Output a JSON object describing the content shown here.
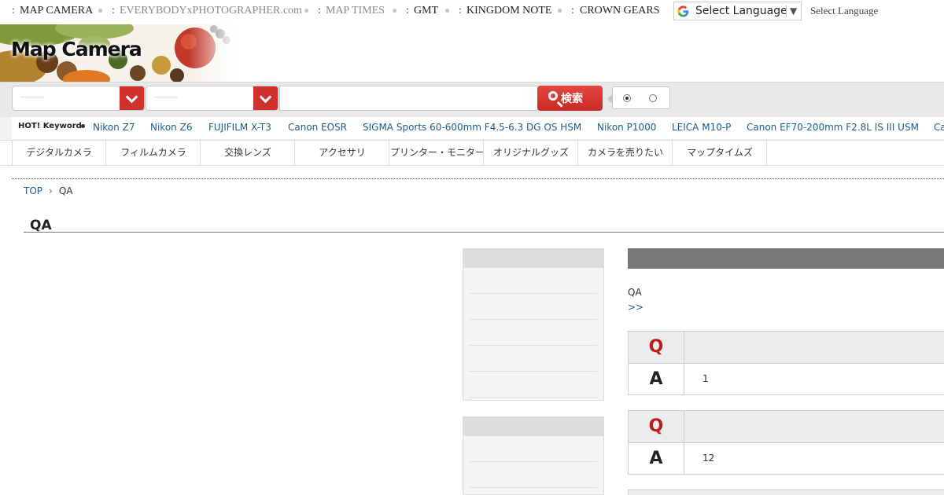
{
  "top_bar": {
    "sites": [
      {
        "label": "MAP CAMERA"
      },
      {
        "label": "EVERYBODYxPHOTOGRAPHER.com"
      },
      {
        "label": "MAP TIMES"
      },
      {
        "label": "GMT"
      },
      {
        "label": "KINGDOM NOTE"
      },
      {
        "label": "CROWN GEARS"
      }
    ],
    "translate": {
      "label": "Select Language",
      "arrow": "▼"
    },
    "translate_label": "Select Language"
  },
  "header": {
    "logo_text": "Map Camera"
  },
  "search": {
    "button_label": "検索",
    "keyword_value": "",
    "radio_selected_index": 0
  },
  "hot_keywords": {
    "label": "HOT! Keyword",
    "items": [
      "Nikon Z7",
      "Nikon Z6",
      "FUJIFILM X-T3",
      "Canon EOSR",
      "SIGMA Sports 60-600mm F4.5-6.3 DG OS HSM",
      "Nikon P1000",
      "LEICA M10-P",
      "Canon EF70-200mm F2.8L IS III USM",
      "Ca"
    ]
  },
  "categories": [
    "デジタルカメラ",
    "フィルムカメラ",
    "交換レンズ",
    "アクセサリ",
    "プリンター・モニター",
    "オリジナルグッズ",
    "カメラを売りたい",
    "マップタイムズ"
  ],
  "breadcrumb": {
    "home": "TOP",
    "separator": "›",
    "current": "QA"
  },
  "page_title": "QA",
  "main": {
    "intro": "QA",
    "more_link": ">>",
    "qa": [
      {
        "q_mark": "Q",
        "a_mark": "A",
        "answer": "1"
      },
      {
        "q_mark": "Q",
        "a_mark": "A",
        "answer": "12"
      }
    ]
  },
  "colors": {
    "accent_red": "#d0312d",
    "link_blue": "#1b5e8a",
    "q_red": "#b81e1e"
  }
}
